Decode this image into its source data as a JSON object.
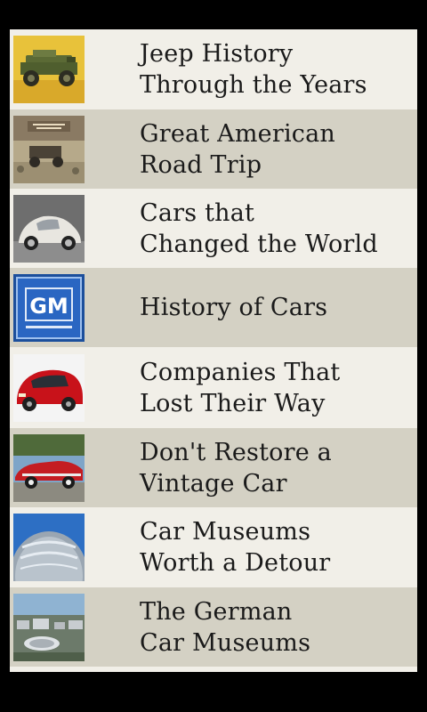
{
  "articles": [
    {
      "line1": "Jeep History",
      "line2": "Through the Years",
      "thumb": "jeep-thumbnail"
    },
    {
      "line1": "Great American",
      "line2": "Road Trip",
      "thumb": "road-trip-thumbnail"
    },
    {
      "line1": "Cars that",
      "line2": "Changed the World",
      "thumb": "beetle-thumbnail"
    },
    {
      "line1": "History of Cars",
      "line2": "",
      "thumb": "gm-logo-thumbnail"
    },
    {
      "line1": "Companies That",
      "line2": "Lost Their Way",
      "thumb": "fiat-thumbnail"
    },
    {
      "line1": "Don't Restore a",
      "line2": "Vintage Car",
      "thumb": "vintage-car-thumbnail"
    },
    {
      "line1": "Car Museums",
      "line2": "Worth a Detour",
      "thumb": "museum-thumbnail"
    },
    {
      "line1": "The German",
      "line2": "Car Museums",
      "thumb": "german-museum-thumbnail"
    }
  ],
  "logos": {
    "gm": "GM"
  },
  "colors": {
    "row_light": "#f1efe8",
    "row_dark": "#d4d1c4",
    "text": "#1a1a1a",
    "background": "#000000"
  }
}
